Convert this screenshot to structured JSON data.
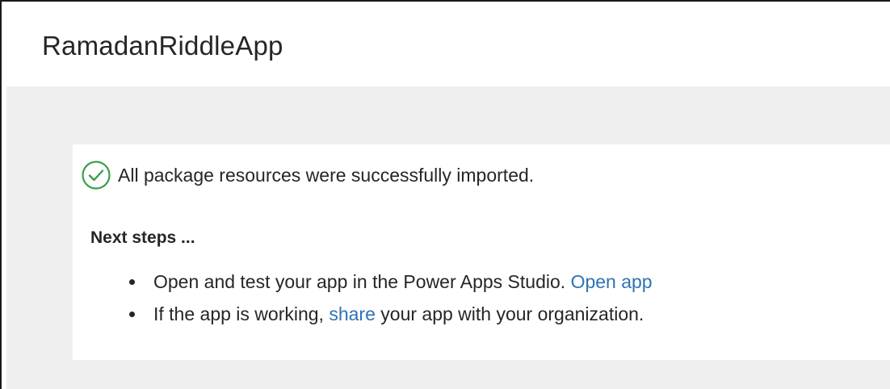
{
  "header": {
    "title": "RamadanRiddleApp"
  },
  "status": {
    "icon": "check-circle-icon",
    "icon_color": "#3a9f4a",
    "message": "All package resources were successfully imported."
  },
  "next_steps": {
    "heading": "Next steps ...",
    "step1": {
      "text": "Open and test your app in the Power Apps Studio.",
      "link_label": "Open app"
    },
    "step2": {
      "text_before": "If the app is working,",
      "link_label": "share",
      "text_after": "your app with your organization."
    }
  },
  "colors": {
    "link": "#2f72b5",
    "background": "#efefef",
    "card": "#ffffff"
  }
}
